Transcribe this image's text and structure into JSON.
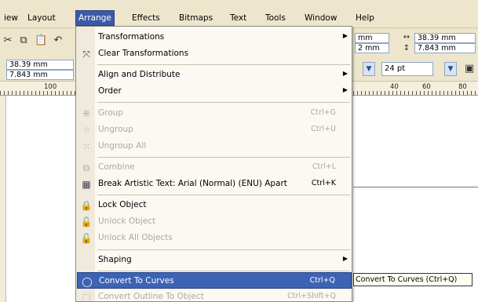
{
  "menubar": {
    "items": [
      "iew",
      "Layout",
      "Arrange",
      "Effects",
      "Bitmaps",
      "Text",
      "Tools",
      "Window",
      "Help"
    ]
  },
  "toolbar": {
    "pos_x": "38.39 mm",
    "pos_y": "7.843 mm",
    "size_w": "mm",
    "size_h": "2 mm",
    "width_val": "38.39 mm",
    "height_val": "7.843 mm",
    "font_size": "24 pt"
  },
  "ruler": {
    "labels": [
      "100",
      "40",
      "60",
      "80"
    ]
  },
  "menu": {
    "items": [
      {
        "label": "Transformations",
        "shortcut": "",
        "submenu": true,
        "disabled": false,
        "icon": ""
      },
      {
        "label": "Clear Transformations",
        "shortcut": "",
        "submenu": false,
        "disabled": false,
        "icon": "clear-transform-icon"
      },
      {
        "label": "Align and Distribute",
        "shortcut": "",
        "submenu": true,
        "disabled": false,
        "icon": ""
      },
      {
        "label": "Order",
        "shortcut": "",
        "submenu": true,
        "disabled": false,
        "icon": ""
      },
      {
        "label": "Group",
        "shortcut": "Ctrl+G",
        "submenu": false,
        "disabled": true,
        "icon": "group-icon"
      },
      {
        "label": "Ungroup",
        "shortcut": "Ctrl+U",
        "submenu": false,
        "disabled": true,
        "icon": "ungroup-icon"
      },
      {
        "label": "Ungroup All",
        "shortcut": "",
        "submenu": false,
        "disabled": true,
        "icon": "ungroup-all-icon"
      },
      {
        "label": "Combine",
        "shortcut": "Ctrl+L",
        "submenu": false,
        "disabled": true,
        "icon": "combine-icon"
      },
      {
        "label": "Break Artistic Text: Arial (Normal) (ENU) Apart",
        "shortcut": "Ctrl+K",
        "submenu": false,
        "disabled": false,
        "icon": "break-apart-icon"
      },
      {
        "label": "Lock Object",
        "shortcut": "",
        "submenu": false,
        "disabled": false,
        "icon": "lock-icon"
      },
      {
        "label": "Unlock Object",
        "shortcut": "",
        "submenu": false,
        "disabled": true,
        "icon": "unlock-icon"
      },
      {
        "label": "Unlock All Objects",
        "shortcut": "",
        "submenu": false,
        "disabled": true,
        "icon": "unlock-all-icon"
      },
      {
        "label": "Shaping",
        "shortcut": "",
        "submenu": true,
        "disabled": false,
        "icon": ""
      },
      {
        "label": "Convert To Curves",
        "shortcut": "Ctrl+Q",
        "submenu": false,
        "disabled": false,
        "icon": "convert-curves-icon"
      },
      {
        "label": "Convert Outline To Object",
        "shortcut": "Ctrl+Shift+Q",
        "submenu": false,
        "disabled": true,
        "icon": "convert-outline-icon"
      }
    ]
  },
  "tooltip": {
    "text": "Convert To Curves (Ctrl+Q)"
  },
  "colors": {
    "highlight": "#3d63b5",
    "menubar_bg": "#ede6cc",
    "disabled_text": "#a8a8a8"
  }
}
